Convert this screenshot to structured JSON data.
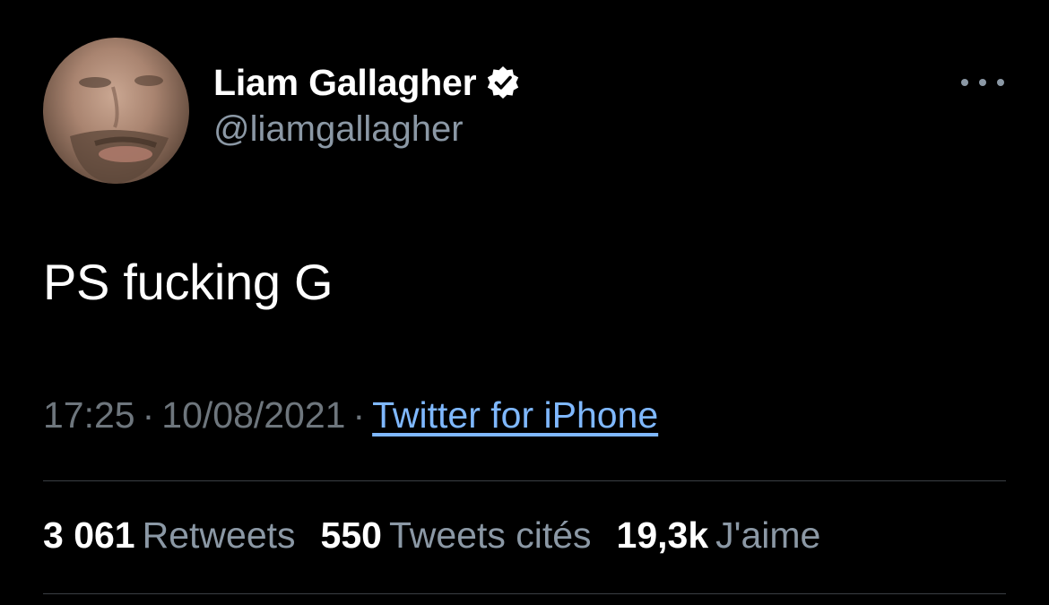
{
  "author": {
    "display_name": "Liam Gallagher",
    "handle": "@liamgallagher",
    "verified": true
  },
  "tweet": {
    "text": "PS fucking G",
    "time": "17:25",
    "date": "10/08/2021",
    "separator": "·",
    "source": "Twitter for iPhone"
  },
  "stats": {
    "retweets_count": "3 061",
    "retweets_label": "Retweets",
    "quotes_count": "550",
    "quotes_label": "Tweets cités",
    "likes_count": "19,3k",
    "likes_label": "J'aime"
  },
  "icons": {
    "more": "more-options-icon",
    "verified": "verified-badge-icon"
  },
  "colors": {
    "background": "#000000",
    "primary_text": "#ffffff",
    "secondary_text": "#8b98a5",
    "link": "#7fb8ff"
  }
}
